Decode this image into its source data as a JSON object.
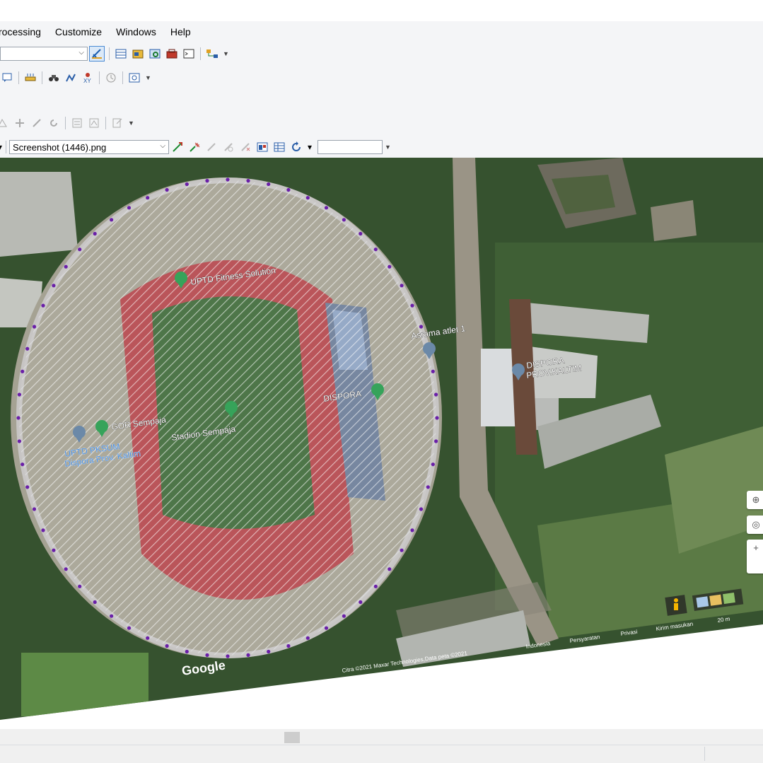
{
  "menu": {
    "items": [
      "rocessing",
      "Customize",
      "Windows",
      "Help"
    ]
  },
  "toolbar": {
    "layer_dropdown_value": "",
    "raster_dropdown_value": "Screenshot (1446).png",
    "search_value": ""
  },
  "map": {
    "labels": {
      "fitness": "UPTD Fitness Solution",
      "asrama": "Asrama atlet 1",
      "dispora_kaltim_1": "DISPORA",
      "dispora_kaltim_2": "PROV.KALTIM",
      "dispora": "DISPORA",
      "gor": "GOR Sempaja",
      "stadion": "Stadion Sempaja",
      "pksum_1": "UPTD PKSUM",
      "pksum_2": "Dispora Prov. Kaltim",
      "google": "Google",
      "attribution": "Citra ©2021 Maxar Technologies,Data peta ©2021",
      "indonesia": "Indonesia",
      "persyaratan": "Persyaratan",
      "privasi": "Privasi",
      "kirim": "Kirim masukan",
      "scale": "20 m"
    },
    "colors": {
      "track": "#b5474c",
      "field": "#3f6b3a",
      "vegetation": "#2f4d2c",
      "vertex": "#6a1fa8",
      "pin": "#36a35a"
    }
  }
}
